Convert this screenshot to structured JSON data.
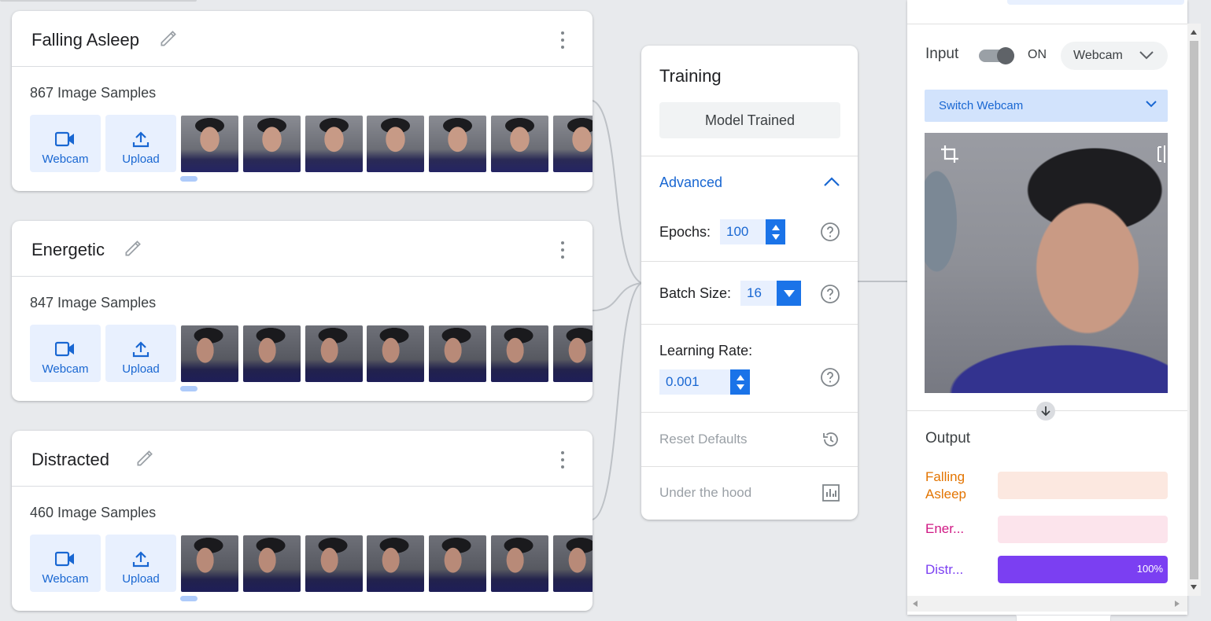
{
  "classes": [
    {
      "name": "Falling Asleep",
      "samples": "867 Image Samples",
      "webcam_label": "Webcam",
      "upload_label": "Upload"
    },
    {
      "name": "Energetic",
      "samples": "847 Image Samples",
      "webcam_label": "Webcam",
      "upload_label": "Upload"
    },
    {
      "name": "Distracted",
      "samples": "460 Image Samples",
      "webcam_label": "Webcam",
      "upload_label": "Upload"
    }
  ],
  "training": {
    "title": "Training",
    "button_label": "Model Trained",
    "advanced_label": "Advanced",
    "epochs_label": "Epochs:",
    "epochs_value": "100",
    "batch_label": "Batch Size:",
    "batch_value": "16",
    "lr_label": "Learning Rate:",
    "lr_value": "0.001",
    "reset_label": "Reset Defaults",
    "hood_label": "Under the hood"
  },
  "preview": {
    "input_label": "Input",
    "toggle_state": "ON",
    "source_label": "Webcam",
    "switch_label": "Switch Webcam",
    "output_title": "Output",
    "outputs": [
      {
        "label": "Falling Asleep",
        "color": "#e37400",
        "bg": "#fce8e0",
        "fill": 0,
        "pct": ""
      },
      {
        "label": "Ener...",
        "color": "#d01884",
        "bg": "#fce4ec",
        "fill": 0,
        "pct": ""
      },
      {
        "label": "Distr...",
        "color": "#7b3ff2",
        "bg": "#ede7f6",
        "fill": 1.0,
        "pct": "100%"
      }
    ]
  }
}
